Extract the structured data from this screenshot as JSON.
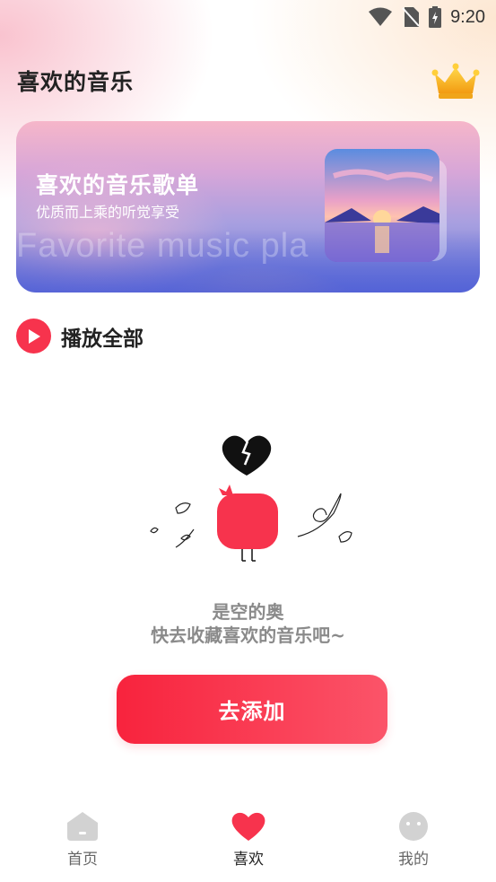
{
  "status_bar": {
    "time": "9:20",
    "icons": [
      "wifi-icon",
      "no-sim-icon",
      "battery-icon"
    ]
  },
  "header": {
    "title": "喜欢的音乐",
    "vip_icon": "crown-icon"
  },
  "banner": {
    "title": "喜欢的音乐歌单",
    "subtitle": "优质而上乘的听觉享受",
    "watermark": "Favorite music pla"
  },
  "play_all": {
    "icon": "play-icon",
    "label": "播放全部"
  },
  "empty_state": {
    "illustration": "broken-heart-character",
    "line1": "是空的奥",
    "line2": "快去收藏喜欢的音乐吧~"
  },
  "add_button": {
    "label": "去添加"
  },
  "tabs": [
    {
      "label": "首页",
      "icon": "home-icon",
      "active": false
    },
    {
      "label": "喜欢",
      "icon": "heart-icon",
      "active": true
    },
    {
      "label": "我的",
      "icon": "face-icon",
      "active": false
    }
  ],
  "colors": {
    "accent": "#f7334d",
    "tab_inactive": "#cccccc",
    "text_dark": "#222222",
    "text_muted": "#8a8a8a"
  }
}
